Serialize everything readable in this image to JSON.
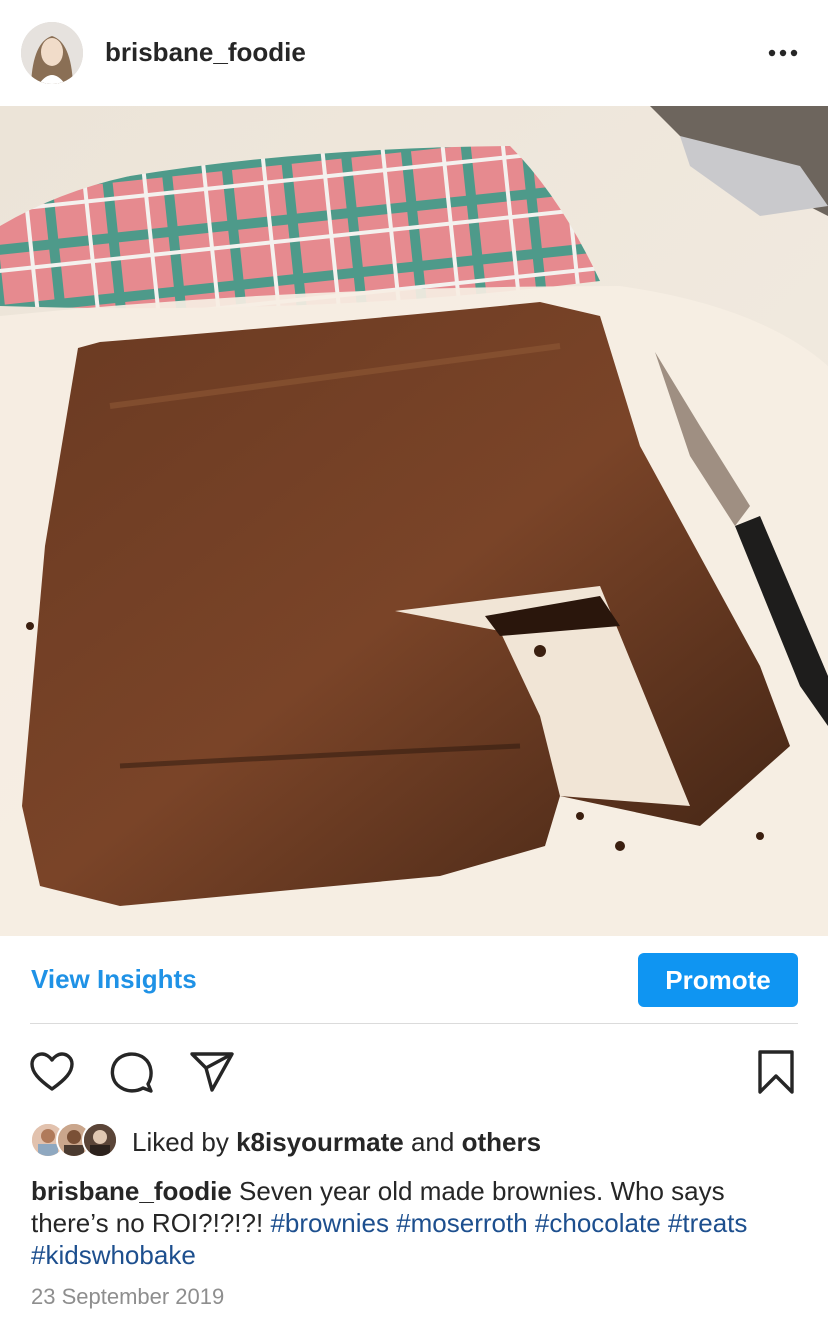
{
  "post": {
    "username": "brisbane_foodie",
    "image_alt": "Tray of homemade chocolate brownies with pieces cut out, knife and plaid tea towel"
  },
  "actions": {
    "view_insights": "View Insights",
    "promote": "Promote"
  },
  "likes": {
    "prefix": "Liked by ",
    "user": "k8isyourmate",
    "middle": " and ",
    "others": "others"
  },
  "caption": {
    "username": "brisbane_foodie",
    "text": " Seven year old made brownies. Who says there’s no ROI?!?!?! ",
    "hashtags": [
      "#brownies",
      "#moserroth",
      "#chocolate",
      "#treats",
      "#kidswhobake"
    ]
  },
  "date": "23 September 2019",
  "colors": {
    "link_blue": "#1f92e6",
    "promote_bg": "#0f95f2",
    "hashtag": "#1d4f8e",
    "muted": "#8e8e8e"
  }
}
